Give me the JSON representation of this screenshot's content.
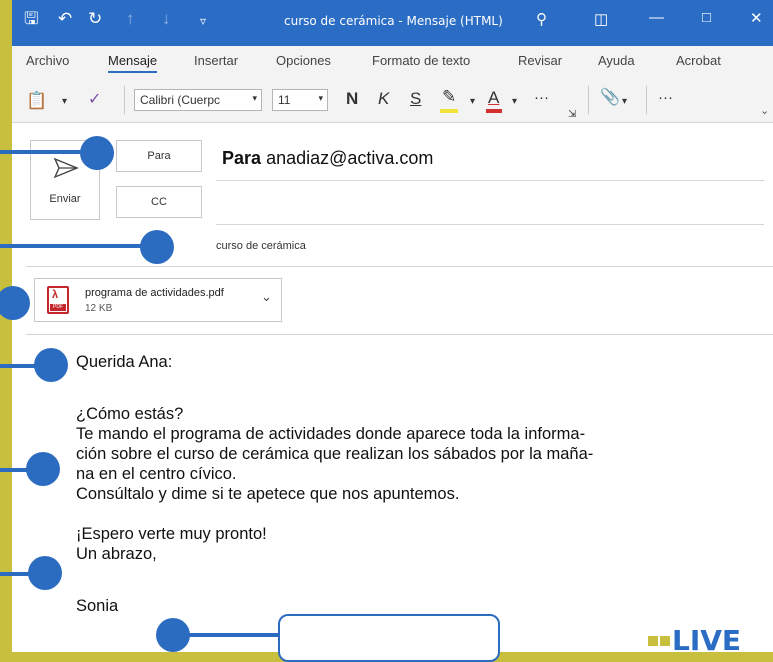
{
  "titlebar": {
    "title": "curso de cerámica - Mensaje (HTML)",
    "qat_icons": [
      "save-icon",
      "undo-icon",
      "redo-icon",
      "up-arrow-icon",
      "down-arrow-icon",
      "customize-icon"
    ],
    "right_icons": [
      "search-icon",
      "ribbon-display-icon",
      "minimize-icon",
      "maximize-icon",
      "close-icon"
    ],
    "color": "#2b6cc4"
  },
  "menu": {
    "tabs": [
      "Archivo",
      "Mensaje",
      "Insertar",
      "Opciones",
      "Formato de texto",
      "Revisar",
      "Ayuda",
      "Acrobat"
    ],
    "active": "Mensaje"
  },
  "ribbon": {
    "font_name": "Calibri (Cuerpc",
    "font_size": "11",
    "bold": "N",
    "italic": "K",
    "underline": "S",
    "more": "···"
  },
  "compose": {
    "send_label": "Enviar",
    "to_button": "Para",
    "cc_button": "CC",
    "to_prefix": "Para",
    "to_value": "anadiaz@activa.com",
    "subject_value": "curso de cerámica"
  },
  "attachment": {
    "name": "programa de actividades.pdf",
    "size": "12 KB",
    "icon_label": "PDF"
  },
  "body": {
    "greeting": "Querida Ana:",
    "line1": "¿Cómo estás?",
    "line2": "Te mando el programa de actividades donde aparece toda la informa-",
    "line3": "ción sobre el curso de cerámica que realizan los sábados por la maña-",
    "line4": "na en el centro cívico.",
    "line5": "Consúltalo y dime si te apetece que nos apuntemos.",
    "line6": "¡Espero verte muy pronto!",
    "line7": "Un abrazo,",
    "signature": "Sonia"
  },
  "logo": {
    "text": "LIVE"
  },
  "overlay": {
    "accent": "#2c6cc0",
    "background": "#c9bf3e"
  }
}
